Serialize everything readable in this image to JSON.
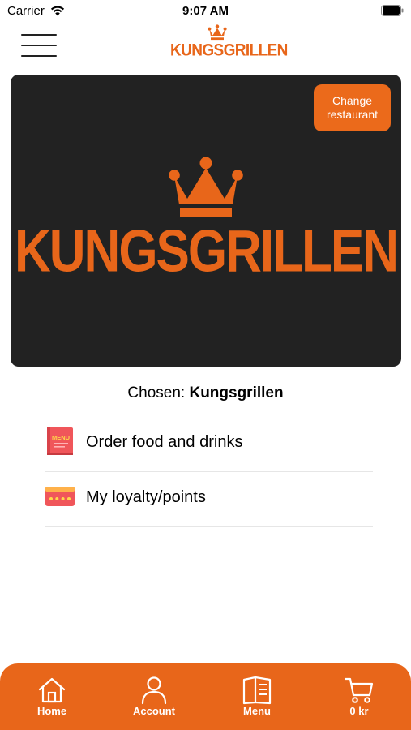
{
  "status_bar": {
    "carrier": "Carrier",
    "time": "9:07 AM"
  },
  "header": {
    "logo_text": "KUNGSGRILLEN",
    "menu_icon": "hamburger-icon"
  },
  "banner": {
    "logo_text": "KUNGSGRILLEN",
    "change_button_line1": "Change",
    "change_button_line2": "restaurant",
    "background_color": "#222222"
  },
  "chosen": {
    "prefix": "Chosen:",
    "restaurant": "Kungsgrillen"
  },
  "menu_items": [
    {
      "label": "Order food and drinks",
      "icon": "menu-book-icon",
      "icon_text": "MENU"
    },
    {
      "label": "My loyalty/points",
      "icon": "loyalty-card-icon"
    }
  ],
  "tabbar": {
    "items": [
      {
        "label": "Home",
        "icon": "home-icon"
      },
      {
        "label": "Account",
        "icon": "account-icon"
      },
      {
        "label": "Menu",
        "icon": "menu-icon"
      },
      {
        "label": "0 kr",
        "icon": "cart-icon"
      }
    ]
  },
  "colors": {
    "brand_orange": "#e8661a",
    "banner_dark": "#222222",
    "menu_icon_red": "#f0565a"
  }
}
